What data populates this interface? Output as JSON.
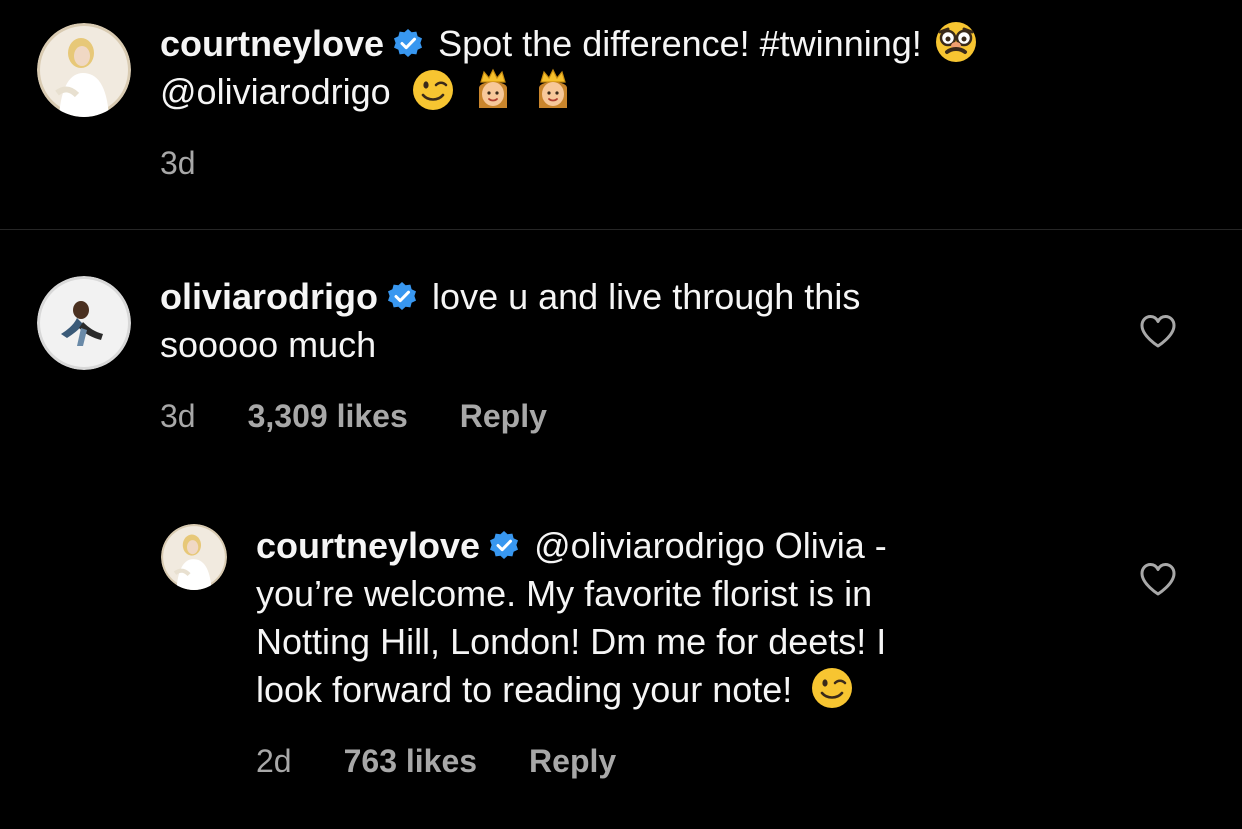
{
  "colors": {
    "background": "#000000",
    "text": "#f5f5f5",
    "secondary_text": "#a8a8a8",
    "verified_blue": "#3897f0",
    "divider": "#262626"
  },
  "caption": {
    "username": "courtneylove",
    "verified": true,
    "text": "Spot the difference! #twinning!",
    "emoji_1": "disguised-face-emoji",
    "mention": "@oliviarodrigo",
    "emojis_2": [
      "winking-face-emoji",
      "princess-emoji",
      "princess-emoji"
    ],
    "time": "3d"
  },
  "comment": {
    "username": "oliviarodrigo",
    "verified": true,
    "text_line_1": "love u and live through this",
    "text_line_2": "sooooo much",
    "time": "3d",
    "likes": "3,309 likes",
    "reply_label": "Reply",
    "like_icon": "heart-icon"
  },
  "reply": {
    "username": "courtneylove",
    "verified": true,
    "mention": "@oliviarodrigo",
    "text_line_1": "Olivia -",
    "text_line_2": "you’re welcome. My favorite florist is in",
    "text_line_3": "Notting Hill, London! Dm me for deets! I",
    "text_line_4": "look forward to reading your note!",
    "emoji": "winking-face-emoji",
    "time": "2d",
    "likes": "763 likes",
    "reply_label": "Reply",
    "like_icon": "heart-icon"
  }
}
